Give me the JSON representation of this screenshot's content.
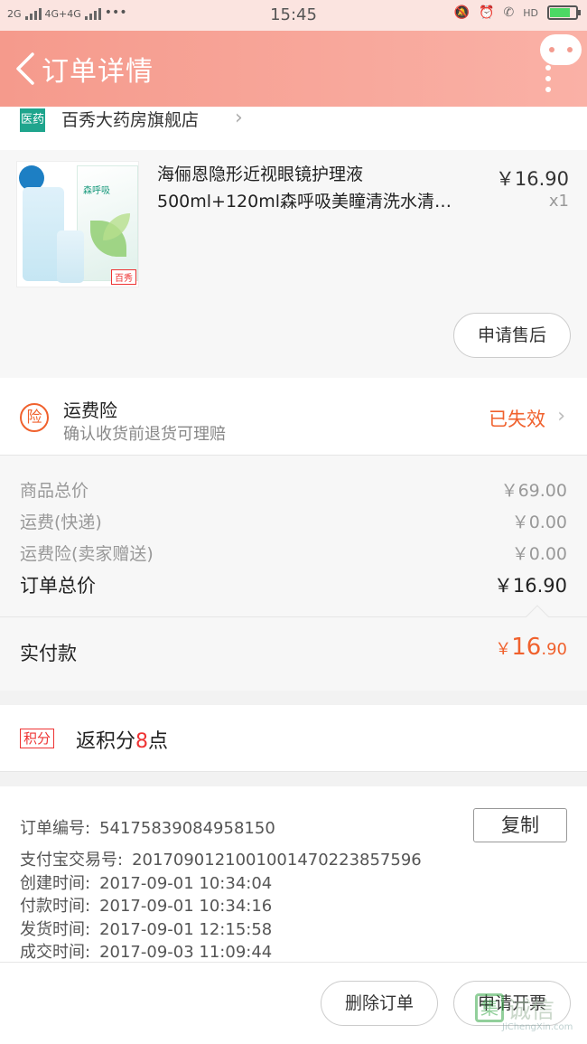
{
  "status_bar": {
    "network_left": "2G",
    "network_right": "4G+4G",
    "dots": "•••",
    "time": "15:45",
    "hd": "HD"
  },
  "header": {
    "title": "订单详情"
  },
  "store": {
    "icon_label": "医药",
    "name": "百秀大药房旗舰店",
    "chevron": "›"
  },
  "product": {
    "name_line1": "海俪恩隐形近视眼镜护理液",
    "name_line2": "500ml+120ml森呼吸美瞳清洗水清…",
    "price": "￥16.90",
    "qty": "x1",
    "after_sale_label": "申请售后",
    "image_text": "森呼吸",
    "image_badge": "百秀"
  },
  "insurance": {
    "icon_label": "险",
    "title": "运费险",
    "subtitle": "确认收货前退货可理赔",
    "status": "已失效"
  },
  "totals": {
    "goods_label": "商品总价",
    "goods_value": "￥69.00",
    "shipping_label": "运费(快递)",
    "shipping_value": "￥0.00",
    "insurance_label": "运费险(卖家赠送)",
    "insurance_value": "￥0.00",
    "order_total_label": "订单总价",
    "order_total_value": "￥16.90"
  },
  "paid": {
    "label": "实付款",
    "currency": "￥",
    "integer": "16",
    "decimal": ".90"
  },
  "points": {
    "tag": "积分",
    "prefix": "返积分",
    "number": "8",
    "suffix": "点"
  },
  "order_info": {
    "order_no_label": "订单编号:",
    "order_no": "54175839084958150",
    "copy_label": "复制",
    "alipay_label": "支付宝交易号:",
    "alipay_no": "2017090121001001470223857596",
    "created_label": "创建时间:",
    "created": "2017-09-01  10:34:04",
    "paid_label": "付款时间:",
    "paid": "2017-09-01  10:34:16",
    "shipped_label": "发货时间:",
    "shipped": "2017-09-01  12:15:58",
    "done_label": "成交时间:",
    "done": "2017-09-03  11:09:44"
  },
  "footer": {
    "delete_label": "删除订单",
    "invoice_label": "申请开票"
  },
  "watermark": {
    "box": "集",
    "cn": "诚信",
    "en": "JiChengXin.com"
  },
  "colors": {
    "header_start": "#f59a8c",
    "header_end": "#fab1a6",
    "accent_orange": "#f0612d",
    "points_red": "#e33",
    "battery_green": "#4cd964"
  },
  "battery_level": 0.8
}
